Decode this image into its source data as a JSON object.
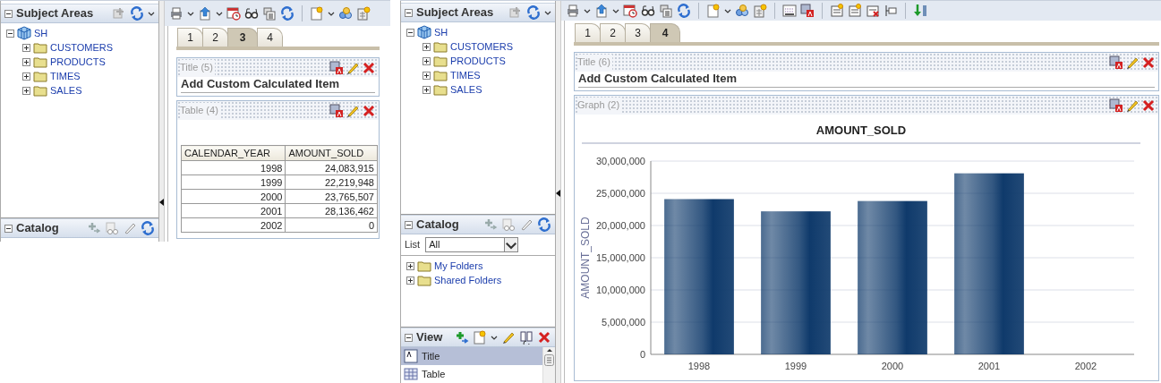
{
  "screens": [
    {
      "subject_areas": {
        "title": "Subject Areas",
        "tree": [
          {
            "label": "SH",
            "kind": "subject_area",
            "expanded": true,
            "children": [
              {
                "label": "CUSTOMERS",
                "kind": "folder",
                "expanded": false
              },
              {
                "label": "PRODUCTS",
                "kind": "folder",
                "expanded": false
              },
              {
                "label": "TIMES",
                "kind": "folder",
                "expanded": false
              },
              {
                "label": "SALES",
                "kind": "folder",
                "expanded": false
              }
            ]
          }
        ]
      },
      "catalog": {
        "title": "Catalog"
      },
      "tabs": [
        {
          "label": "1",
          "selected": false
        },
        {
          "label": "2",
          "selected": false
        },
        {
          "label": "3",
          "selected": true
        },
        {
          "label": "4",
          "selected": false
        }
      ],
      "views": [
        {
          "kind": "title",
          "header": "Title (5)",
          "text": "Add Custom Calculated Item"
        },
        {
          "kind": "table",
          "header": "Table (4)",
          "columns": [
            "CALENDAR_YEAR",
            "AMOUNT_SOLD"
          ],
          "rows": [
            [
              "1998",
              "24,083,915"
            ],
            [
              "1999",
              "22,219,948"
            ],
            [
              "2000",
              "23,765,507"
            ],
            [
              "2001",
              "28,136,462"
            ],
            [
              "2002",
              "0"
            ]
          ]
        }
      ]
    },
    {
      "subject_areas": {
        "title": "Subject Areas",
        "tree": [
          {
            "label": "SH",
            "kind": "subject_area",
            "expanded": true,
            "children": [
              {
                "label": "CUSTOMERS",
                "kind": "folder",
                "expanded": false
              },
              {
                "label": "PRODUCTS",
                "kind": "folder",
                "expanded": false
              },
              {
                "label": "TIMES",
                "kind": "folder",
                "expanded": false
              },
              {
                "label": "SALES",
                "kind": "folder",
                "expanded": false
              }
            ]
          }
        ]
      },
      "catalog": {
        "title": "Catalog",
        "list_label": "List",
        "list_value": "All",
        "tree": [
          {
            "label": "My Folders",
            "kind": "folder",
            "expanded": false
          },
          {
            "label": "Shared Folders",
            "kind": "folder",
            "expanded": false
          }
        ]
      },
      "view_panel": {
        "title": "View",
        "items": [
          {
            "label": "Title",
            "kind": "title",
            "selected": true
          },
          {
            "label": "Table",
            "kind": "table",
            "selected": false
          }
        ]
      },
      "tabs": [
        {
          "label": "1",
          "selected": false
        },
        {
          "label": "2",
          "selected": false
        },
        {
          "label": "3",
          "selected": false
        },
        {
          "label": "4",
          "selected": true
        }
      ],
      "views": [
        {
          "kind": "title",
          "header": "Title (6)",
          "text": "Add Custom Calculated Item"
        },
        {
          "kind": "graph",
          "header": "Graph (2)",
          "chart_data": {
            "type": "bar",
            "title": "AMOUNT_SOLD",
            "ylabel": "AMOUNT_SOLD",
            "categories": [
              "1998",
              "1999",
              "2000",
              "2001",
              "2002"
            ],
            "series": [
              {
                "color": "#0f3a6b",
                "values": [
                  24100000,
                  22200000,
                  23800000,
                  28100000,
                  0
                ]
              }
            ],
            "grid": true,
            "ylim": [
              0,
              30000000
            ],
            "yticks": [
              {
                "value": 0,
                "label": "0"
              },
              {
                "value": 5000000,
                "label": "5,000,000"
              },
              {
                "value": 10000000,
                "label": "10,000,000"
              },
              {
                "value": 15000000,
                "label": "15,000,000"
              },
              {
                "value": 20000000,
                "label": "20,000,000"
              },
              {
                "value": 25000000,
                "label": "25,000,000"
              },
              {
                "value": 30000000,
                "label": "30,000,000"
              }
            ]
          }
        }
      ]
    }
  ]
}
